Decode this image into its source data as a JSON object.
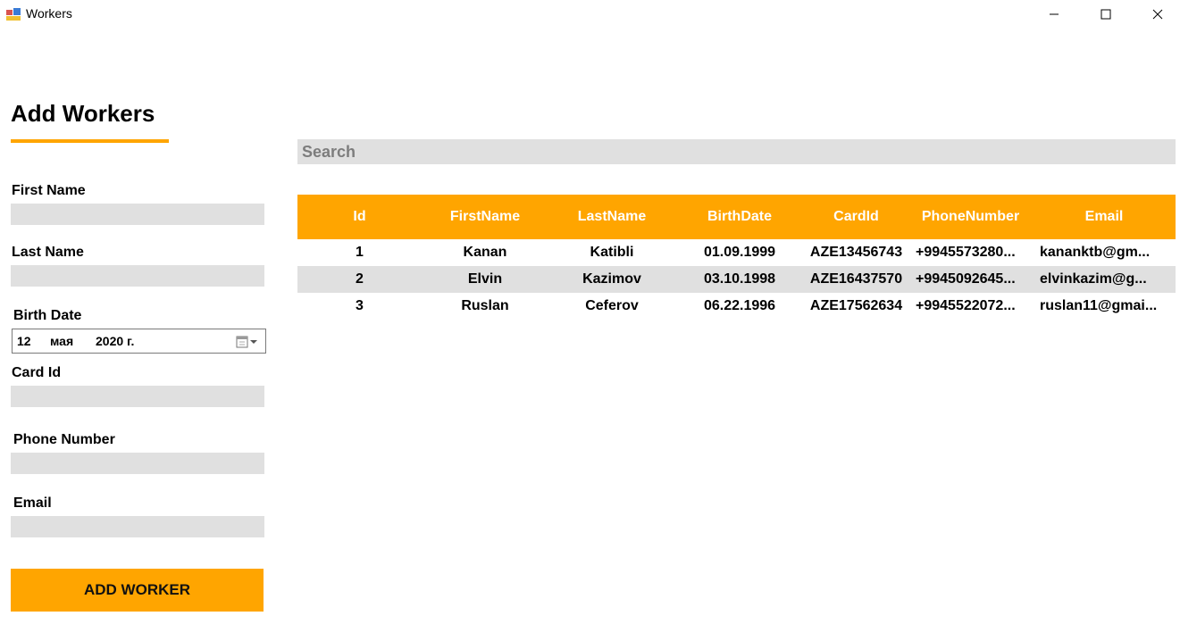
{
  "window": {
    "title": "Workers",
    "icon": "winforms-app-icon",
    "controls": [
      "minimize-icon",
      "maximize-icon",
      "close-icon"
    ]
  },
  "form": {
    "heading": "Add Workers",
    "first_name_label": "First Name",
    "first_name_value": "",
    "last_name_label": "Last Name",
    "last_name_value": "",
    "birth_date_label": "Birth Date",
    "birth_date": {
      "day": "12",
      "month": "мая",
      "year": "2020 г."
    },
    "card_id_label": "Card Id",
    "card_id_value": "",
    "phone_label": "Phone Number",
    "phone_value": "",
    "email_label": "Email",
    "email_value": "",
    "add_button": "ADD WORKER"
  },
  "search": {
    "placeholder": "Search",
    "value": ""
  },
  "grid": {
    "columns": [
      "Id",
      "FirstName",
      "LastName",
      "BirthDate",
      "CardId",
      "PhoneNumber",
      "Email"
    ],
    "rows": [
      [
        "1",
        "Kanan",
        "Katibli",
        "01.09.1999",
        "AZE13456743",
        "+9945573280...",
        "kananktb@gm..."
      ],
      [
        "2",
        "Elvin",
        "Kazimov",
        "03.10.1998",
        "AZE16437570",
        "+9945092645...",
        "elvinkazim@g..."
      ],
      [
        "3",
        "Ruslan",
        "Ceferov",
        "06.22.1996",
        "AZE17562634",
        "+9945522072...",
        "ruslan11@gmai..."
      ]
    ]
  },
  "colors": {
    "accent": "#ffa500",
    "input_bg": "#e0e0e0",
    "alt_row": "#e0e0e0"
  }
}
